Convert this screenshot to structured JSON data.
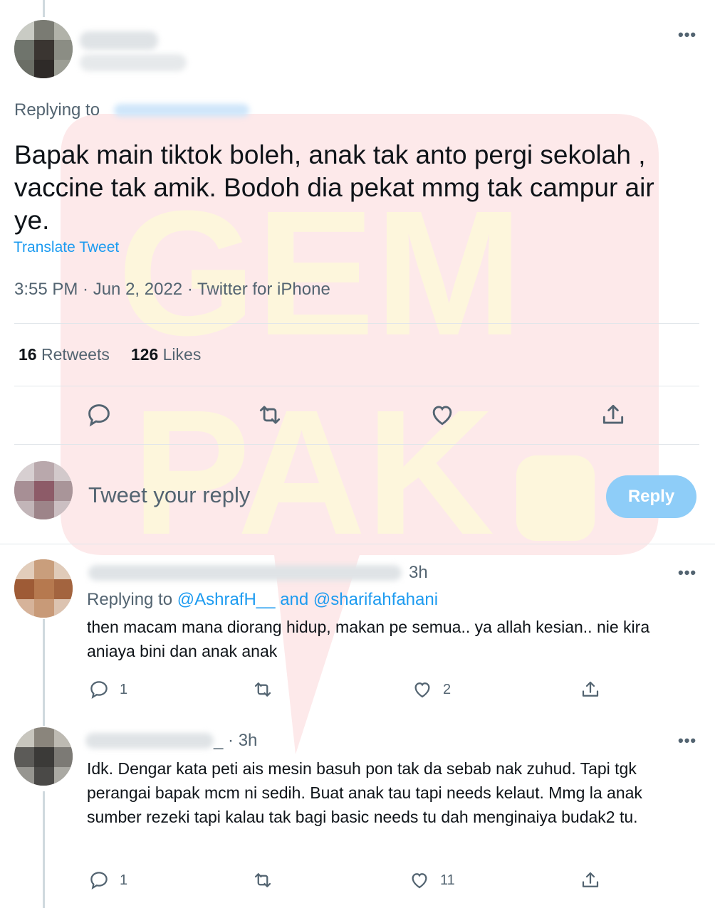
{
  "tweet": {
    "replying_label": "Replying to",
    "text": "Bapak main tiktok boleh, anak tak anto pergi sekolah , vaccine tak amik. Bodoh dia pekat mmg tak campur air ye.",
    "translate_label": "Translate Tweet",
    "meta": "3:55 PM · Jun 2, 2022 · Twitter for iPhone",
    "retweets_count": "16",
    "retweets_label": "Retweets",
    "likes_count": "126",
    "likes_label": "Likes"
  },
  "compose": {
    "placeholder": "Tweet your reply",
    "reply_button": "Reply"
  },
  "replies": [
    {
      "time": "3h",
      "replying_prefix": "Replying to",
      "mention_1": "@AshrafH__",
      "mention_join": "and",
      "mention_2": "@sharifahfahani",
      "text": "then macam mana diorang hidup, makan pe semua.. ya allah kesian.. nie kira aniaya bini dan anak anak",
      "reply_count": "1",
      "like_count": "2"
    },
    {
      "time": "3h",
      "handle_tail": "_ ·",
      "text": "Idk. Dengar kata peti ais mesin basuh pon tak da sebab nak zuhud. Tapi tgk perangai bapak mcm ni sedih. Buat anak tau tapi needs kelaut. Mmg la anak sumber rezeki tapi kalau tak bagi basic needs tu dah menginaiya budak2 tu.",
      "reply_count": "1",
      "like_count": "11"
    }
  ],
  "icons": {
    "more": "more-horizontal-icon",
    "reply": "reply-bubble-icon",
    "retweet": "retweet-icon",
    "like": "heart-icon",
    "share": "share-icon"
  },
  "colors": {
    "accent": "#1d9bf0",
    "reply_button_disabled": "#8ecdf8",
    "muted_text": "#536471",
    "watermark_red": "#fde9ea",
    "watermark_yellow": "#fdf7e0"
  }
}
